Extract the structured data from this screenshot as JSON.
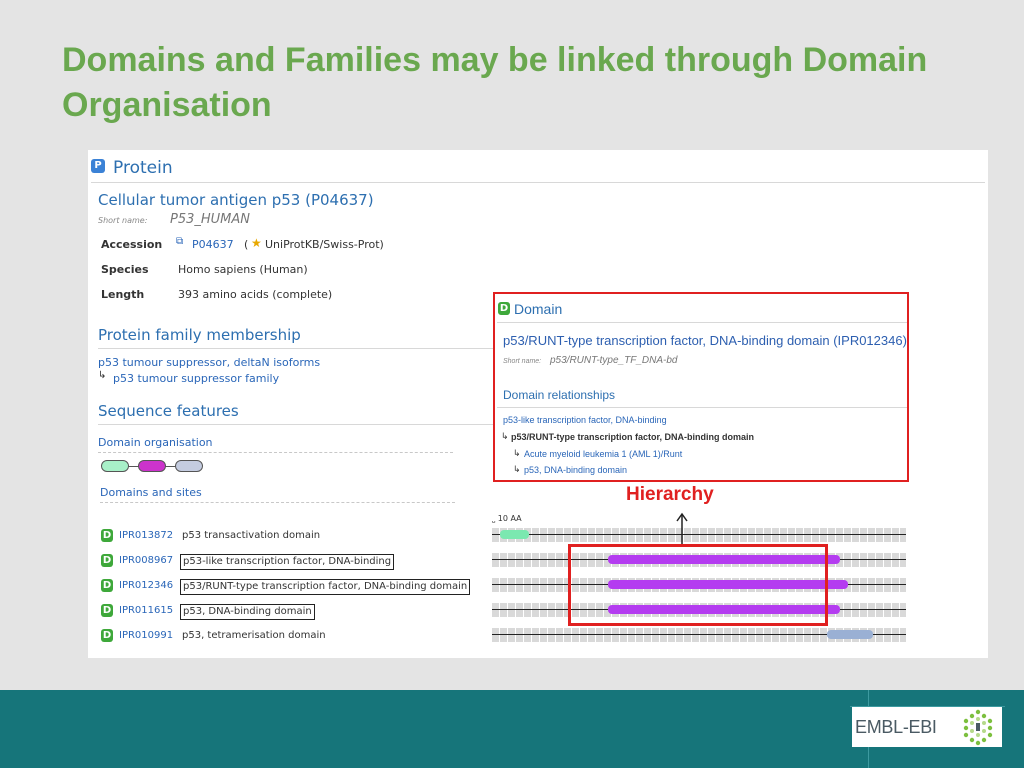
{
  "slide_title": "Domains and Families may be linked through Domain Organisation",
  "panel": {
    "header_icon": "P",
    "header_title": "Protein",
    "protein_name": "Cellular tumor antigen p53 (P04637)",
    "short_name_label": "Short name:",
    "short_name_value": "P53_HUMAN",
    "accession_label": "Accession",
    "accession_id": "P04637",
    "accession_open": "(",
    "accession_source": "UniProtKB/Swiss-Prot)",
    "species_label": "Species",
    "species_value": "Homo sapiens (Human)",
    "length_label": "Length",
    "length_value": "393 amino acids (complete)",
    "family_title": "Protein family membership",
    "family_item_1": "p53 tumour suppressor, deltaN isoforms",
    "family_item_2": "p53 tumour suppressor family",
    "seq_title": "Sequence features",
    "domain_org_title": "Domain organisation",
    "domains_sites_title": "Domains and sites",
    "scale_label": "10 AA",
    "pills": [
      {
        "color": "#a8f0c8"
      },
      {
        "color": "#cc33cc"
      },
      {
        "color": "#c4cce0"
      }
    ],
    "rows": [
      {
        "icon": "D",
        "id": "IPR013872",
        "desc": "p53 transactivation domain",
        "boxed": false,
        "bar_color": "#7be8b0",
        "start": 2,
        "end": 9
      },
      {
        "icon": "D",
        "id": "IPR008967",
        "desc": "p53-like transcription factor, DNA-binding",
        "boxed": true,
        "bar_color": "#b43cf0",
        "start": 28,
        "end": 84
      },
      {
        "icon": "D",
        "id": "IPR012346",
        "desc": "p53/RUNT-type transcription factor, DNA-binding domain",
        "boxed": true,
        "bar_color": "#b43cf0",
        "start": 28,
        "end": 86
      },
      {
        "icon": "D",
        "id": "IPR011615",
        "desc": "p53, DNA-binding domain",
        "boxed": true,
        "bar_color": "#b43cf0",
        "start": 28,
        "end": 84
      },
      {
        "icon": "D",
        "id": "IPR010991",
        "desc": "p53, tetramerisation domain",
        "boxed": false,
        "bar_color": "#9ab0d4",
        "start": 81,
        "end": 92
      }
    ]
  },
  "callout": {
    "icon": "D",
    "header_title": "Domain",
    "domain_name": "p53/RUNT-type transcription factor, DNA-binding domain (IPR012346)",
    "short_name_label": "Short name:",
    "short_name_value": "p53/RUNT-type_TF_DNA-bd",
    "relationships_title": "Domain relationships",
    "rel_parent": "p53-like transcription factor, DNA-binding",
    "rel_current": "p53/RUNT-type transcription factor, DNA-binding domain",
    "rel_child_1": "Acute myeloid leukemia 1 (AML 1)/Runt",
    "rel_child_2": "p53, DNA-binding domain"
  },
  "annotation_label": "Hierarchy",
  "logo_text": "EMBL-EBI",
  "colors": {
    "title_green": "#6aa84f",
    "footer_teal": "#16757a",
    "accent_red": "#e02020",
    "link_blue": "#2a66b8"
  }
}
